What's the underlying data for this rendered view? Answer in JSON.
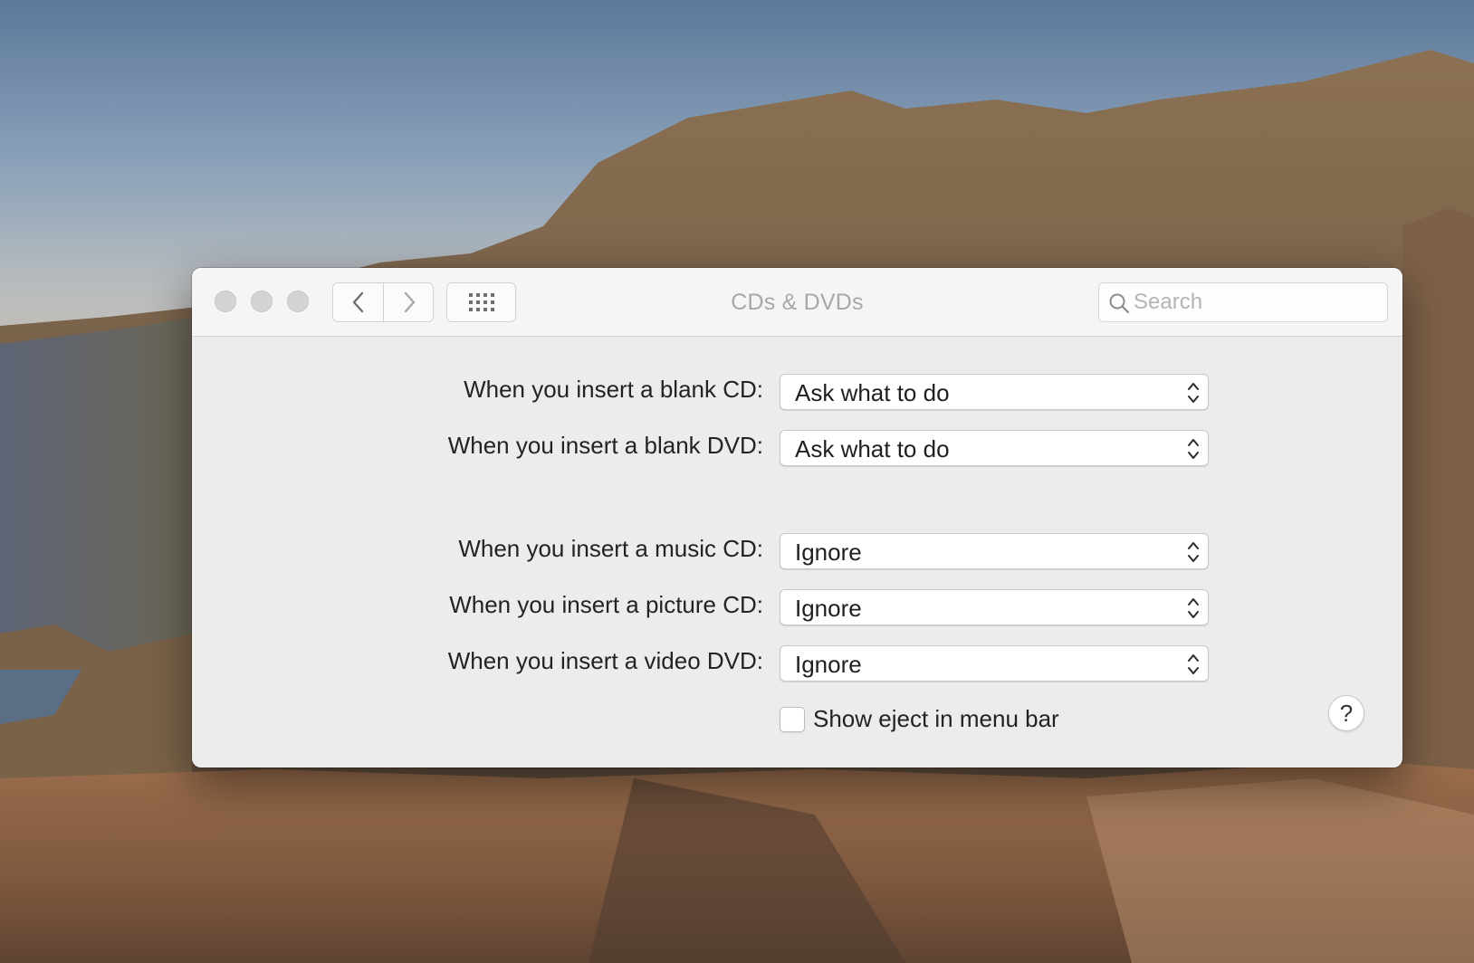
{
  "window": {
    "title": "CDs & DVDs"
  },
  "toolbar": {
    "back_icon": "chevron-left-icon",
    "forward_icon": "chevron-right-icon",
    "show_all_icon": "grid-icon",
    "search": {
      "placeholder": "Search",
      "value": ""
    }
  },
  "settings": {
    "blank_cd": {
      "label": "When you insert a blank CD:",
      "value": "Ask what to do"
    },
    "blank_dvd": {
      "label": "When you insert a blank DVD:",
      "value": "Ask what to do"
    },
    "music_cd": {
      "label": "When you insert a music CD:",
      "value": "Ignore"
    },
    "picture_cd": {
      "label": "When you insert a picture CD:",
      "value": "Ignore"
    },
    "video_dvd": {
      "label": "When you insert a video DVD:",
      "value": "Ignore"
    }
  },
  "show_eject": {
    "label": "Show eject in menu bar",
    "checked": false
  },
  "help": {
    "label": "?"
  }
}
